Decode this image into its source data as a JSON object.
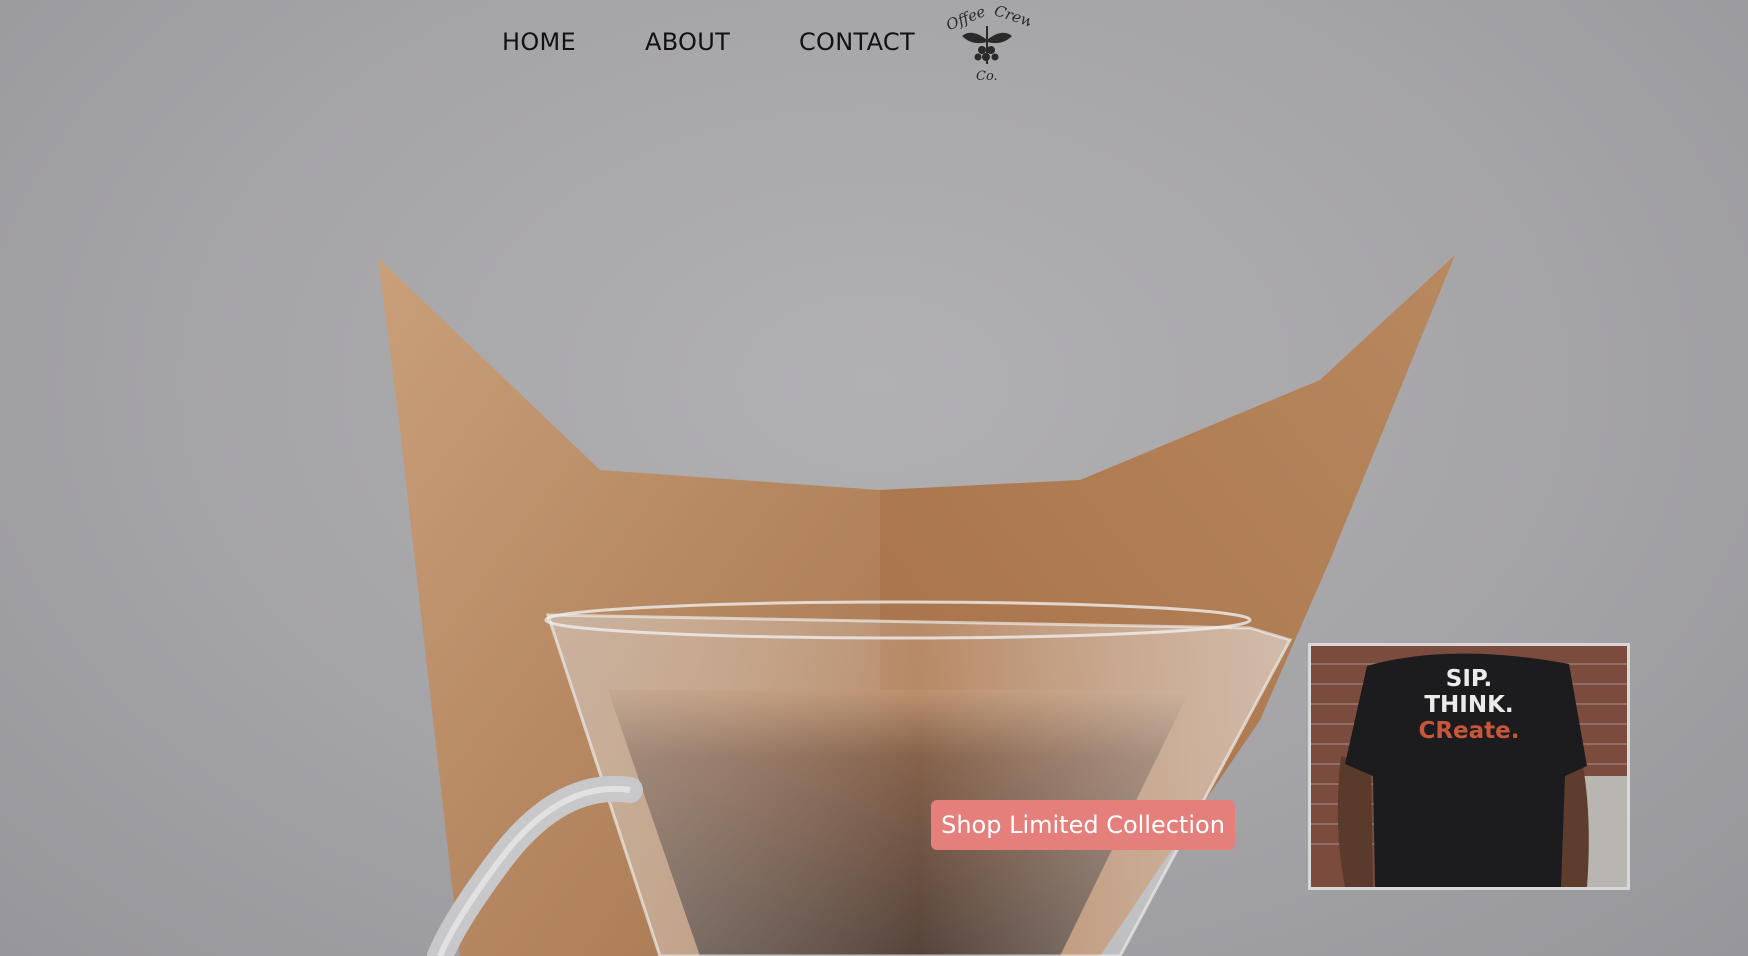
{
  "nav": {
    "items": [
      {
        "label": "HOME"
      },
      {
        "label": "ABOUT"
      },
      {
        "label": "CONTACT"
      }
    ],
    "logo": {
      "icon": "coffee-branch-logo",
      "line1": "Offee",
      "line2": "Crew",
      "line3": "Co."
    }
  },
  "hero": {
    "cta_label": "Shop Limited Collection",
    "colors": {
      "cta": "#e57f7c",
      "background": "#a4a3a6",
      "filter_paper": "#b98a62"
    }
  },
  "promo": {
    "shirt_lines": [
      "SIP.",
      "THINK.",
      "CReate."
    ]
  }
}
